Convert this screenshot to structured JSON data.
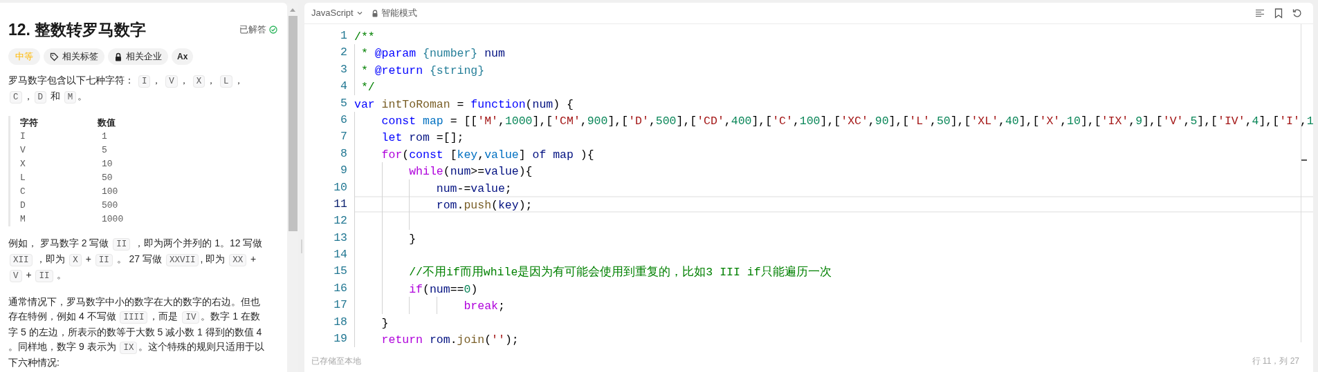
{
  "problem": {
    "title": "12. 整数转罗马数字",
    "status": {
      "label": "已解答",
      "solved": true
    },
    "tags": [
      {
        "kind": "difficulty",
        "label": "中等"
      },
      {
        "kind": "topics",
        "label": "相关标签"
      },
      {
        "kind": "companies",
        "label": "相关企业"
      },
      {
        "kind": "font",
        "label": "Ax"
      }
    ],
    "description": [
      {
        "kind": "paragraph",
        "segments": [
          {
            "kind": "text",
            "text": "罗马数字包含以下七种字符： "
          },
          {
            "kind": "code",
            "text": "I"
          },
          {
            "kind": "text",
            "text": "， "
          },
          {
            "kind": "code",
            "text": "V"
          },
          {
            "kind": "text",
            "text": "， "
          },
          {
            "kind": "code",
            "text": "X"
          },
          {
            "kind": "text",
            "text": "， "
          },
          {
            "kind": "code",
            "text": "L"
          },
          {
            "kind": "text",
            "text": "，"
          },
          {
            "kind": "code",
            "text": "C"
          },
          {
            "kind": "text",
            "text": "，"
          },
          {
            "kind": "code",
            "text": "D"
          },
          {
            "kind": "text",
            "text": " 和 "
          },
          {
            "kind": "code",
            "text": "M"
          },
          {
            "kind": "text",
            "text": "。"
          }
        ]
      },
      {
        "kind": "table",
        "columns": [
          "字符",
          "数值"
        ],
        "rows": [
          [
            "I",
            "1"
          ],
          [
            "V",
            "5"
          ],
          [
            "X",
            "10"
          ],
          [
            "L",
            "50"
          ],
          [
            "C",
            "100"
          ],
          [
            "D",
            "500"
          ],
          [
            "M",
            "1000"
          ]
        ]
      },
      {
        "kind": "paragraph",
        "segments": [
          {
            "kind": "text",
            "text": "例如， 罗马数字 2 写做 "
          },
          {
            "kind": "code",
            "text": "II"
          },
          {
            "kind": "text",
            "text": " ，即为两个并列的 1。12 写做 "
          },
          {
            "kind": "code",
            "text": "XII"
          },
          {
            "kind": "text",
            "text": " ，即为 "
          },
          {
            "kind": "code",
            "text": "X"
          },
          {
            "kind": "text",
            "text": " + "
          },
          {
            "kind": "code",
            "text": "II"
          },
          {
            "kind": "text",
            "text": " 。 27 写做  "
          },
          {
            "kind": "code",
            "text": "XXVII"
          },
          {
            "kind": "text",
            "text": ", 即为 "
          },
          {
            "kind": "code",
            "text": "XX"
          },
          {
            "kind": "text",
            "text": " + "
          },
          {
            "kind": "code",
            "text": "V"
          },
          {
            "kind": "text",
            "text": " + "
          },
          {
            "kind": "code",
            "text": "II"
          },
          {
            "kind": "text",
            "text": " 。"
          }
        ]
      },
      {
        "kind": "paragraph",
        "segments": [
          {
            "kind": "text",
            "text": "通常情况下，罗马数字中小的数字在大的数字的右边。但也存在特例，例如 4 不写做 "
          },
          {
            "kind": "code",
            "text": "IIII"
          },
          {
            "kind": "text",
            "text": "，而是 "
          },
          {
            "kind": "code",
            "text": "IV"
          },
          {
            "kind": "text",
            "text": "。数字 1 在数字 5 的左边，所表示的数等于大数 5 减小数 1 得到的数值 4 。同样地，数字 9 表示为 "
          },
          {
            "kind": "code",
            "text": "IX"
          },
          {
            "kind": "text",
            "text": "。这个特殊的规则只适用于以下六种情况:"
          }
        ]
      }
    ]
  },
  "editor": {
    "language": "JavaScript",
    "mode": "智能模式",
    "lines": [
      {
        "number": "1",
        "current": false,
        "tokens": [
          {
            "kind": "comment",
            "text": "/**"
          }
        ]
      },
      {
        "number": "2",
        "current": false,
        "tokens": [
          {
            "kind": "comment",
            "text": " * "
          },
          {
            "kind": "doctag",
            "text": "@param"
          },
          {
            "kind": "doctype",
            "text": " {number}"
          },
          {
            "kind": "variable",
            "text": " num"
          }
        ]
      },
      {
        "number": "3",
        "current": false,
        "tokens": [
          {
            "kind": "comment",
            "text": " * "
          },
          {
            "kind": "doctag",
            "text": "@return"
          },
          {
            "kind": "doctype",
            "text": " {string}"
          }
        ]
      },
      {
        "number": "4",
        "current": false,
        "tokens": [
          {
            "kind": "comment",
            "text": " */"
          }
        ]
      },
      {
        "number": "5",
        "current": false,
        "tokens": [
          {
            "kind": "keyword",
            "text": "var"
          },
          {
            "kind": "function",
            "text": " intToRoman"
          },
          {
            "kind": "plain",
            "text": " = "
          },
          {
            "kind": "keyword",
            "text": "function"
          },
          {
            "kind": "plain",
            "text": "("
          },
          {
            "kind": "variable",
            "text": "num"
          },
          {
            "kind": "plain",
            "text": ") {"
          }
        ]
      },
      {
        "number": "6",
        "current": false,
        "tokens": [
          {
            "kind": "keyword",
            "text": "    const"
          },
          {
            "kind": "constant",
            "text": " map"
          },
          {
            "kind": "plain",
            "text": " = [["
          },
          {
            "kind": "string",
            "text": "'M'"
          },
          {
            "kind": "plain",
            "text": ","
          },
          {
            "kind": "number",
            "text": "1000"
          },
          {
            "kind": "plain",
            "text": "],["
          },
          {
            "kind": "string",
            "text": "'CM'"
          },
          {
            "kind": "plain",
            "text": ","
          },
          {
            "kind": "number",
            "text": "900"
          },
          {
            "kind": "plain",
            "text": "],["
          },
          {
            "kind": "string",
            "text": "'D'"
          },
          {
            "kind": "plain",
            "text": ","
          },
          {
            "kind": "number",
            "text": "500"
          },
          {
            "kind": "plain",
            "text": "],["
          },
          {
            "kind": "string",
            "text": "'CD'"
          },
          {
            "kind": "plain",
            "text": ","
          },
          {
            "kind": "number",
            "text": "400"
          },
          {
            "kind": "plain",
            "text": "],["
          },
          {
            "kind": "string",
            "text": "'C'"
          },
          {
            "kind": "plain",
            "text": ","
          },
          {
            "kind": "number",
            "text": "100"
          },
          {
            "kind": "plain",
            "text": "],["
          },
          {
            "kind": "string",
            "text": "'XC'"
          },
          {
            "kind": "plain",
            "text": ","
          },
          {
            "kind": "number",
            "text": "90"
          },
          {
            "kind": "plain",
            "text": "],["
          },
          {
            "kind": "string",
            "text": "'L'"
          },
          {
            "kind": "plain",
            "text": ","
          },
          {
            "kind": "number",
            "text": "50"
          },
          {
            "kind": "plain",
            "text": "],["
          },
          {
            "kind": "string",
            "text": "'XL'"
          },
          {
            "kind": "plain",
            "text": ","
          },
          {
            "kind": "number",
            "text": "40"
          },
          {
            "kind": "plain",
            "text": "],["
          },
          {
            "kind": "string",
            "text": "'X'"
          },
          {
            "kind": "plain",
            "text": ","
          },
          {
            "kind": "number",
            "text": "10"
          },
          {
            "kind": "plain",
            "text": "],["
          },
          {
            "kind": "string",
            "text": "'IX'"
          },
          {
            "kind": "plain",
            "text": ","
          },
          {
            "kind": "number",
            "text": "9"
          },
          {
            "kind": "plain",
            "text": "],["
          },
          {
            "kind": "string",
            "text": "'V'"
          },
          {
            "kind": "plain",
            "text": ","
          },
          {
            "kind": "number",
            "text": "5"
          },
          {
            "kind": "plain",
            "text": "],["
          },
          {
            "kind": "string",
            "text": "'IV'"
          },
          {
            "kind": "plain",
            "text": ","
          },
          {
            "kind": "number",
            "text": "4"
          },
          {
            "kind": "plain",
            "text": "],["
          },
          {
            "kind": "string",
            "text": "'I'"
          },
          {
            "kind": "plain",
            "text": ","
          },
          {
            "kind": "number",
            "text": "1"
          }
        ]
      },
      {
        "number": "7",
        "current": false,
        "tokens": [
          {
            "kind": "keyword",
            "text": "    let"
          },
          {
            "kind": "variable",
            "text": " rom"
          },
          {
            "kind": "plain",
            "text": " =[];"
          }
        ]
      },
      {
        "number": "8",
        "current": false,
        "tokens": [
          {
            "kind": "control",
            "text": "    for"
          },
          {
            "kind": "plain",
            "text": "("
          },
          {
            "kind": "keyword",
            "text": "const"
          },
          {
            "kind": "plain",
            "text": " ["
          },
          {
            "kind": "constant",
            "text": "key"
          },
          {
            "kind": "plain",
            "text": ","
          },
          {
            "kind": "constant",
            "text": "value"
          },
          {
            "kind": "plain",
            "text": "] "
          },
          {
            "kind": "variable",
            "text": "of map"
          },
          {
            "kind": "plain",
            "text": " ){"
          }
        ]
      },
      {
        "number": "9",
        "current": false,
        "tokens": [
          {
            "kind": "control",
            "text": "        while"
          },
          {
            "kind": "plain",
            "text": "("
          },
          {
            "kind": "variable",
            "text": "num"
          },
          {
            "kind": "plain",
            "text": ">="
          },
          {
            "kind": "variable",
            "text": "value"
          },
          {
            "kind": "plain",
            "text": "){"
          }
        ]
      },
      {
        "number": "10",
        "current": false,
        "tokens": [
          {
            "kind": "variable",
            "text": "            num"
          },
          {
            "kind": "plain",
            "text": "-="
          },
          {
            "kind": "variable",
            "text": "value"
          },
          {
            "kind": "plain",
            "text": ";"
          }
        ]
      },
      {
        "number": "11",
        "current": true,
        "tokens": [
          {
            "kind": "variable",
            "text": "            rom"
          },
          {
            "kind": "plain",
            "text": "."
          },
          {
            "kind": "function",
            "text": "push"
          },
          {
            "kind": "plain",
            "text": "("
          },
          {
            "kind": "variable",
            "text": "key"
          },
          {
            "kind": "plain",
            "text": ");"
          }
        ]
      },
      {
        "number": "12",
        "current": false
      },
      {
        "number": "13",
        "current": false,
        "tokens": [
          {
            "kind": "plain",
            "text": "        }"
          }
        ]
      },
      {
        "number": "14",
        "current": false
      },
      {
        "number": "15",
        "current": false,
        "tokens": [
          {
            "kind": "comment",
            "text": "        //不用if而用while是因为有可能会使用到重复的，比如3 III if只能遍历一次"
          }
        ]
      },
      {
        "number": "16",
        "current": false,
        "tokens": [
          {
            "kind": "control",
            "text": "        if"
          },
          {
            "kind": "plain",
            "text": "("
          },
          {
            "kind": "variable",
            "text": "num"
          },
          {
            "kind": "plain",
            "text": "=="
          },
          {
            "kind": "number",
            "text": "0"
          },
          {
            "kind": "plain",
            "text": ")"
          }
        ]
      },
      {
        "number": "17",
        "current": false,
        "tokens": [
          {
            "kind": "control",
            "text": "                break"
          },
          {
            "kind": "plain",
            "text": ";"
          }
        ]
      },
      {
        "number": "18",
        "current": false,
        "tokens": [
          {
            "kind": "plain",
            "text": "    }"
          }
        ]
      },
      {
        "number": "19",
        "current": false,
        "tokens": [
          {
            "kind": "control",
            "text": "    return"
          },
          {
            "kind": "variable",
            "text": " rom"
          },
          {
            "kind": "plain",
            "text": "."
          },
          {
            "kind": "function",
            "text": "join"
          },
          {
            "kind": "plain",
            "text": "("
          },
          {
            "kind": "string",
            "text": "''"
          },
          {
            "kind": "plain",
            "text": ");"
          }
        ]
      }
    ],
    "save_status": "已存储至本地",
    "cursor": "行 11，列 27"
  }
}
